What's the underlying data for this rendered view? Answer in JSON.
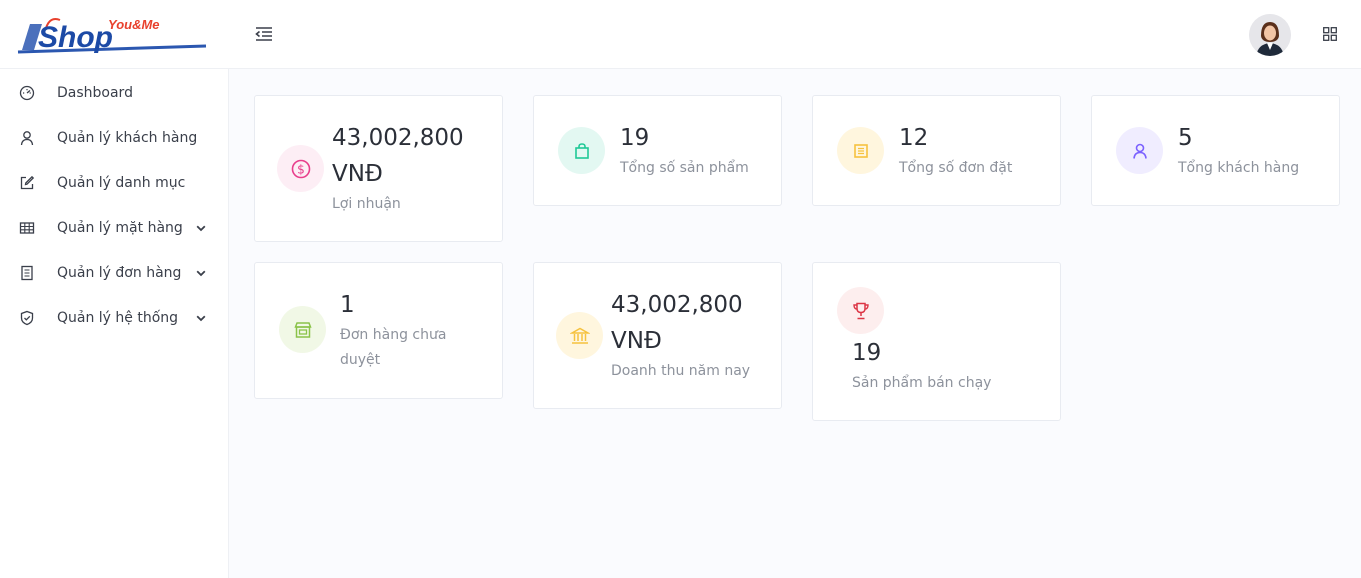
{
  "header": {
    "logo_icon": "youme-shop-logo",
    "logo_small": "You&Me",
    "logo_big": "Shop",
    "menu_toggle_icon": "menu-collapse-icon",
    "avatar_icon": "user-avatar",
    "apps_icon": "grid-apps-icon"
  },
  "sidebar": {
    "items": [
      {
        "label": "Dashboard",
        "icon": "dashboard-gauge-icon",
        "has_submenu": false
      },
      {
        "label": "Quản lý khách hàng",
        "icon": "user-icon",
        "has_submenu": false
      },
      {
        "label": "Quản lý danh mục",
        "icon": "edit-icon",
        "has_submenu": false
      },
      {
        "label": "Quản lý mặt hàng",
        "icon": "table-icon",
        "has_submenu": true
      },
      {
        "label": "Quản lý đơn hàng",
        "icon": "receipt-icon",
        "has_submenu": true
      },
      {
        "label": "Quản lý hệ thống",
        "icon": "shield-icon",
        "has_submenu": true
      }
    ]
  },
  "stats": [
    {
      "value_line1": "43,002,800",
      "value_line2": "VNĐ",
      "label": "Lợi nhuận",
      "icon": "dollar-coin-icon",
      "color": "#e83e8c"
    },
    {
      "value": "19",
      "label": "Tổng số sản phẩm",
      "icon": "shopping-bag-icon",
      "color": "#20c997"
    },
    {
      "value": "12",
      "label": "Tổng số đơn đặt",
      "icon": "order-list-icon",
      "color": "#f6c23e"
    },
    {
      "value": "5",
      "label": "Tổng khách hàng",
      "icon": "user-icon",
      "color": "#7b61ff"
    },
    {
      "value": "1",
      "label_line1": "Đơn hàng chưa",
      "label_line2": "duyệt",
      "icon": "store-icon",
      "color": "#8bc34a"
    },
    {
      "value_line1": "43,002,800",
      "value_line2": "VNĐ",
      "label": "Doanh thu năm nay",
      "icon": "bank-icon",
      "color": "#f6c23e"
    },
    {
      "value": "19",
      "label": "Sản phẩm bán chạy",
      "icon": "trophy-icon",
      "color": "#dc3545"
    }
  ]
}
